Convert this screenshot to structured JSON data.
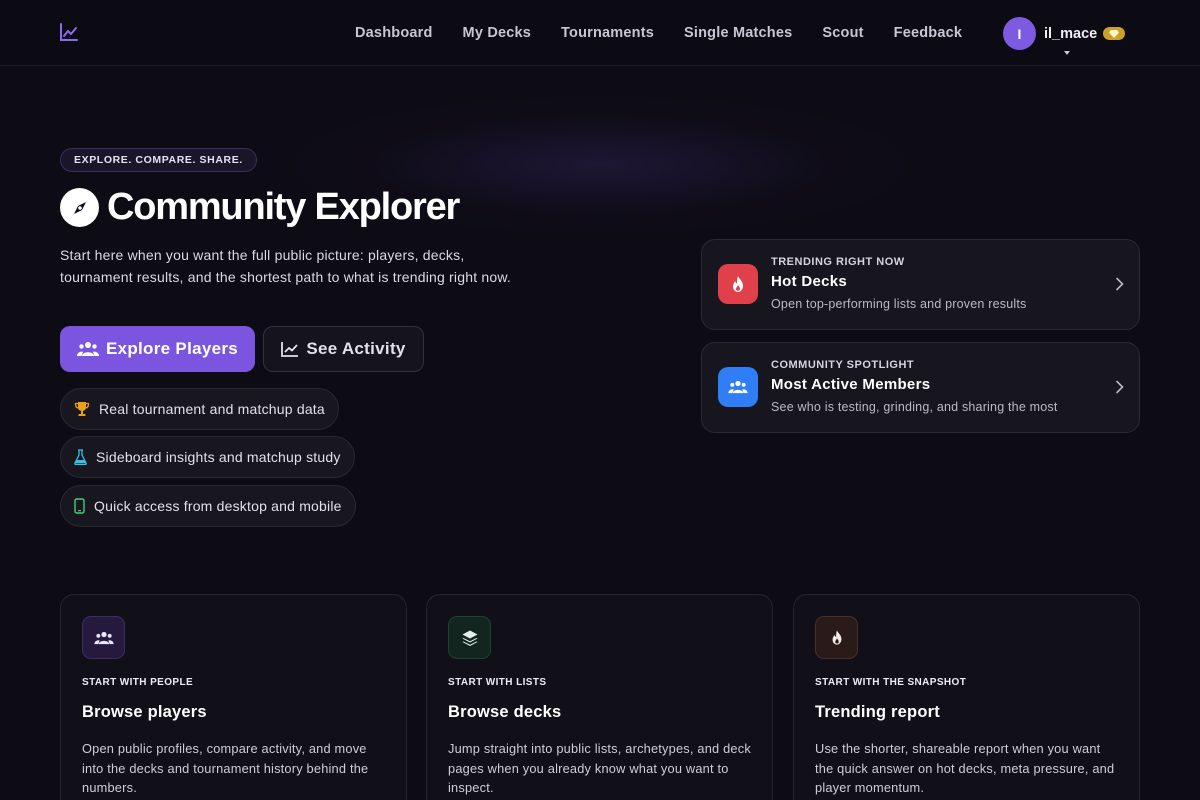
{
  "nav": {
    "links": [
      "Dashboard",
      "My Decks",
      "Tournaments",
      "Single Matches",
      "Scout",
      "Feedback"
    ],
    "user": {
      "initial": "I",
      "name": "il_mace"
    }
  },
  "hero": {
    "pill": "EXPLORE. COMPARE. SHARE.",
    "title": "Community Explorer",
    "description": "Start here when you want the full public picture: players, decks, tournament results, and the shortest path to what is trending right now.",
    "primary_button": "Explore Players",
    "secondary_button": "See Activity",
    "features": [
      {
        "label": "Real tournament and matchup data",
        "icon": "trophy-icon"
      },
      {
        "label": "Sideboard insights and matchup study",
        "icon": "flask-icon"
      },
      {
        "label": "Quick access from desktop and mobile",
        "icon": "mobile-icon"
      }
    ]
  },
  "highlights": [
    {
      "kicker": "TRENDING RIGHT NOW",
      "title": "Hot Decks",
      "subtitle": "Open top-performing lists and proven results",
      "icon": "fire-icon",
      "color": "#e0404a"
    },
    {
      "kicker": "COMMUNITY SPOTLIGHT",
      "title": "Most Active Members",
      "subtitle": "See who is testing, grinding, and sharing the most",
      "icon": "users-icon",
      "color": "#2f7ef5"
    }
  ],
  "cards": [
    {
      "kicker": "START WITH PEOPLE",
      "title": "Browse players",
      "description": "Open public profiles, compare activity, and move into the decks and tournament history behind the numbers.",
      "icon": "users-icon"
    },
    {
      "kicker": "START WITH LISTS",
      "title": "Browse decks",
      "description": "Jump straight into public lists, archetypes, and deck pages when you already know what you want to inspect.",
      "icon": "layers-icon"
    },
    {
      "kicker": "START WITH THE SNAPSHOT",
      "title": "Trending report",
      "description": "Use the shorter, shareable report when you want the quick answer on hot decks, meta pressure, and player momentum.",
      "icon": "fire-icon"
    }
  ],
  "colors": {
    "accent": "#7b55e0",
    "background": "#0d0b14",
    "gold": "#c9a227"
  }
}
